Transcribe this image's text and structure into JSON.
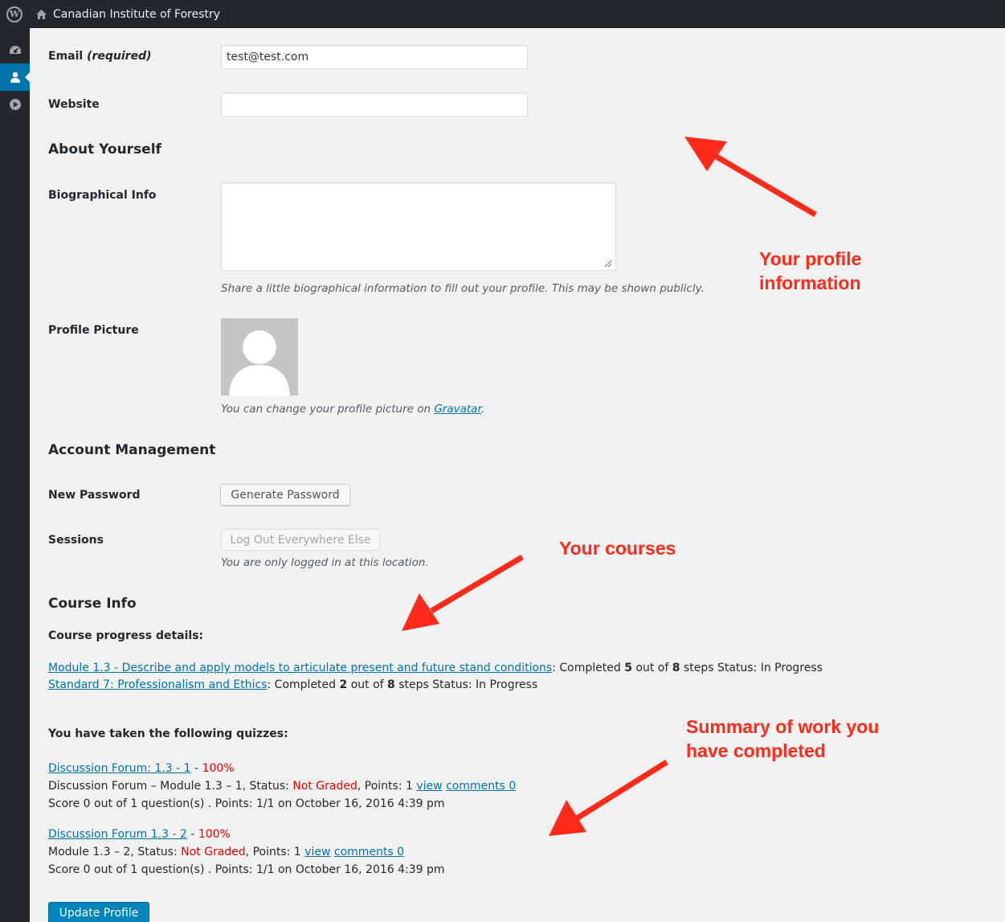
{
  "adminbar": {
    "site_name": "Canadian Institute of Forestry",
    "logo_glyph": "W"
  },
  "form": {
    "email_label": "Email",
    "email_required": "(required)",
    "email_value": "test@test.com",
    "website_label": "Website",
    "website_value": "",
    "about_heading": "About Yourself",
    "bio_label": "Biographical Info",
    "bio_value": "",
    "bio_desc": "Share a little biographical information to fill out your profile. This may be shown publicly.",
    "picture_label": "Profile Picture",
    "picture_desc_prefix": "You can change your profile picture on",
    "picture_desc_link": "Gravatar",
    "picture_desc_suffix": ".",
    "account_heading": "Account Management",
    "password_label": "New Password",
    "generate_password": "Generate Password",
    "sessions_label": "Sessions",
    "logout_everywhere": "Log Out Everywhere Else",
    "sessions_desc": "You are only logged in at this location."
  },
  "course": {
    "heading": "Course Info",
    "progress_label": "Course progress details:",
    "courses": [
      {
        "title": "Module 1.3 - Describe and apply models to articulate present and future stand conditions",
        "completed_prefix": ": Completed",
        "done": "5",
        "out_of": "out of",
        "total": "8",
        "status": "steps Status: In Progress"
      },
      {
        "title": "Standard 7: Professionalism and Ethics",
        "completed_prefix": ": Completed",
        "done": "2",
        "out_of": "out of",
        "total": "8",
        "status": "steps Status: In Progress"
      }
    ],
    "quizzes_label": "You have taken the following quizzes:",
    "quizzes": [
      {
        "title": "Discussion Forum: 1.3 - 1",
        "sep": " - ",
        "percent": "100%",
        "line2_prefix": "Discussion Forum – Module 1.3 – 1, Status:",
        "status": "Not Graded",
        "points": ", Points: 1",
        "view": "view",
        "comments": "comments 0",
        "line3": "Score 0 out of 1 question(s) . Points: 1/1 on October 16, 2016 4:39 pm"
      },
      {
        "title": "Discussion Forum 1.3 - 2",
        "sep": " - ",
        "percent": "100%",
        "line2_prefix": "Module 1.3 – 2, Status:",
        "status": "Not Graded",
        "points": ", Points: 1",
        "view": "view",
        "comments": "comments 0",
        "line3": "Score 0 out of 1 question(s) . Points: 1/1 on October 16, 2016 4:39 pm"
      }
    ]
  },
  "update_button": "Update Profile",
  "annotations": {
    "profile_line1": "Your profile",
    "profile_line2": "information",
    "courses": "Your courses",
    "summary_line1": "Summary of work you",
    "summary_line2": "have completed",
    "color": "#ff2a1a"
  },
  "icons": {
    "adminbar": [
      "wordpress-logo-icon",
      "home-icon"
    ],
    "sidemenu": [
      "dashboard-icon",
      "user-icon",
      "play-icon"
    ]
  }
}
